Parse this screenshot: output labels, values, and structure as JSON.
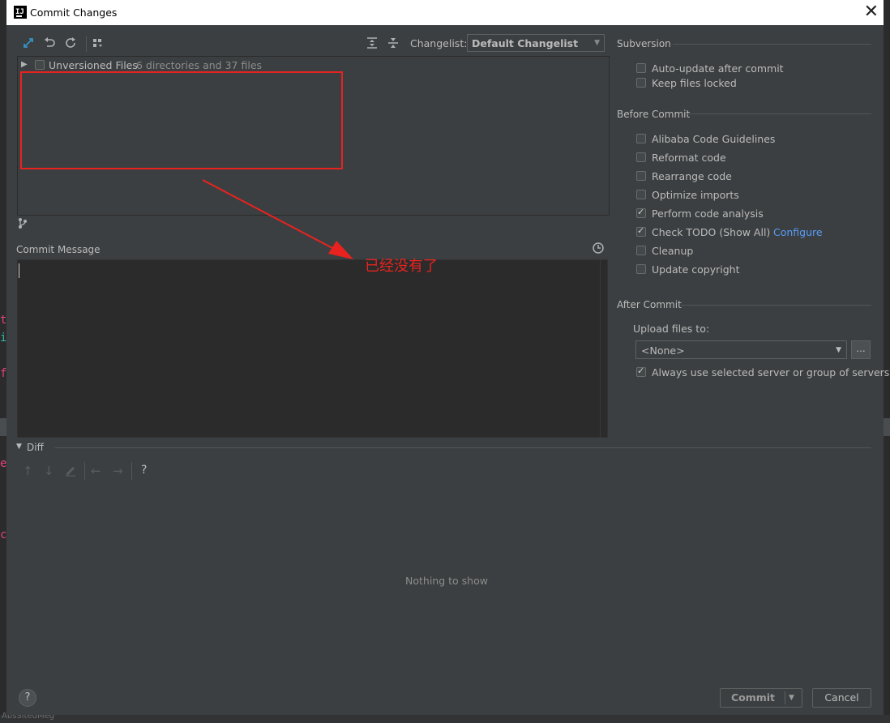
{
  "window": {
    "title": "Commit Changes"
  },
  "toolbar": {
    "changelist_label": "Changelist:",
    "changelist_value": "Default Changelist"
  },
  "tree": {
    "root_label": "Unversioned Files",
    "root_summary": "6 directories and 37 files"
  },
  "commit_message": {
    "label": "Commit Message",
    "text": ""
  },
  "annotation": {
    "text": "已经没有了",
    "color": "#e8231f"
  },
  "subversion": {
    "heading": "Subversion",
    "options": [
      {
        "label": "Auto-update after commit",
        "checked": false
      },
      {
        "label": "Keep files locked",
        "checked": false
      }
    ]
  },
  "before_commit": {
    "heading": "Before Commit",
    "options": [
      {
        "label": "Alibaba Code Guidelines",
        "checked": false
      },
      {
        "label": "Reformat code",
        "checked": false
      },
      {
        "label": "Rearrange code",
        "checked": false
      },
      {
        "label": "Optimize imports",
        "checked": false
      },
      {
        "label": "Perform code analysis",
        "checked": true
      },
      {
        "label": "Check TODO (Show All)",
        "checked": true,
        "link": "Configure"
      },
      {
        "label": "Cleanup",
        "checked": false
      },
      {
        "label": "Update copyright",
        "checked": false
      }
    ]
  },
  "after_commit": {
    "heading": "After Commit",
    "upload_label": "Upload files to:",
    "upload_value": "<None>",
    "browse_label": "...",
    "always_use": {
      "label": "Always use selected server or group of servers",
      "checked": true
    }
  },
  "diff": {
    "heading": "Diff",
    "empty_text": "Nothing to show",
    "help_glyph": "?"
  },
  "footer": {
    "commit_label": "Commit",
    "cancel_label": "Cancel",
    "help_glyph": "?"
  },
  "background": {
    "snippet": "AbsSitedMeg"
  },
  "colors": {
    "accent": "#3592c4",
    "link": "#589df6",
    "annotation_red": "#e8231f"
  }
}
